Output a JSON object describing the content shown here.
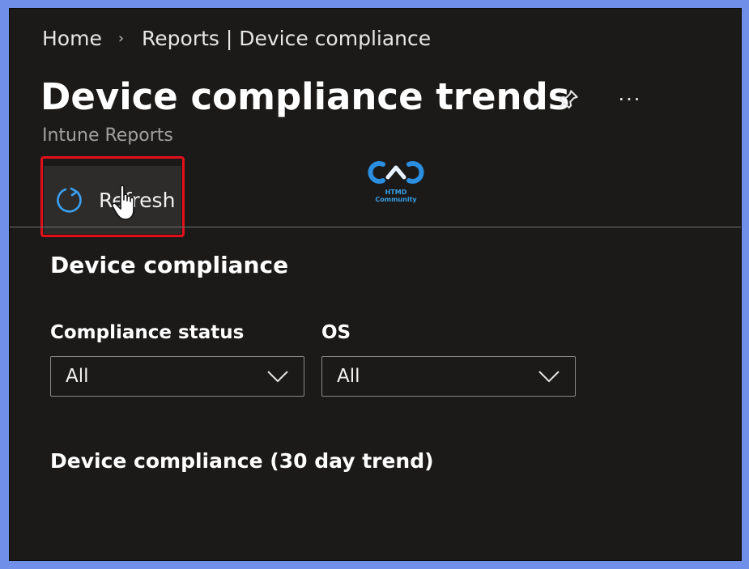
{
  "breadcrumb": {
    "home": "Home",
    "current": "Reports | Device compliance"
  },
  "header": {
    "title": "Device compliance trends",
    "subtitle": "Intune Reports",
    "pin_icon": "pin-icon",
    "more_icon": "more-icon",
    "more_glyph": "···"
  },
  "toolbar": {
    "refresh_label": "Refresh",
    "refresh_icon": "refresh-icon",
    "highlight_color": "#e3101b"
  },
  "watermark": {
    "text": "HTMD Community",
    "color": "#3aa0e6"
  },
  "section": {
    "title": "Device compliance"
  },
  "filters": {
    "compliance_status": {
      "label": "Compliance status",
      "value": "All"
    },
    "os": {
      "label": "OS",
      "value": "All"
    }
  },
  "trend": {
    "title": "Device compliance (30 day trend)"
  }
}
